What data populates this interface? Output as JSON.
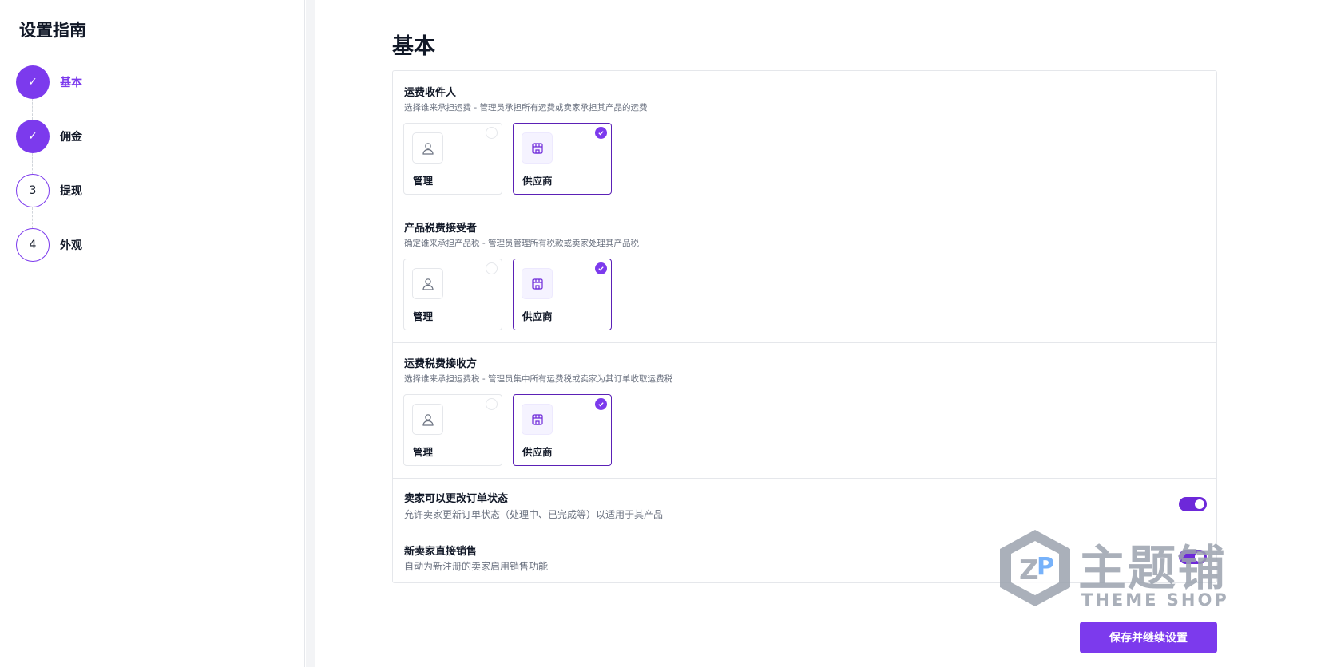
{
  "sidebar": {
    "title": "设置指南",
    "steps": [
      {
        "marker": "✓",
        "label": "基本",
        "state": "done-active"
      },
      {
        "marker": "✓",
        "label": "佣金",
        "state": "done"
      },
      {
        "marker": "3",
        "label": "提现",
        "state": "todo"
      },
      {
        "marker": "4",
        "label": "外观",
        "state": "todo"
      }
    ]
  },
  "main": {
    "title": "基本",
    "sections": [
      {
        "title": "运费收件人",
        "description": "选择谁来承担运费 - 管理员承担所有运费或卖家承担其产品的运费",
        "options": [
          {
            "label": "管理",
            "icon": "user-icon",
            "selected": false
          },
          {
            "label": "供应商",
            "icon": "store-icon",
            "selected": true
          }
        ]
      },
      {
        "title": "产品税费接受者",
        "description": "确定谁来承担产品税 - 管理员管理所有税款或卖家处理其产品税",
        "options": [
          {
            "label": "管理",
            "icon": "user-icon",
            "selected": false
          },
          {
            "label": "供应商",
            "icon": "store-icon",
            "selected": true
          }
        ]
      },
      {
        "title": "运费税费接收方",
        "description": "选择谁来承担运费税 - 管理员集中所有运费税或卖家为其订单收取运费税",
        "options": [
          {
            "label": "管理",
            "icon": "user-icon",
            "selected": false
          },
          {
            "label": "供应商",
            "icon": "store-icon",
            "selected": true
          }
        ]
      }
    ],
    "toggles": [
      {
        "title": "卖家可以更改订单状态",
        "description": "允许卖家更新订单状态（处理中、已完成等）以适用于其产品",
        "on": true
      },
      {
        "title": "新卖家直接销售",
        "description": "自动为新注册的卖家启用销售功能",
        "on": true
      }
    ],
    "save_label": "保存并继续设置"
  },
  "watermark": {
    "text": "主题铺",
    "sub": "THEME SHOP"
  },
  "colors": {
    "accent": "#7c3aed",
    "border": "#e5e7eb",
    "muted": "#6b7280"
  }
}
